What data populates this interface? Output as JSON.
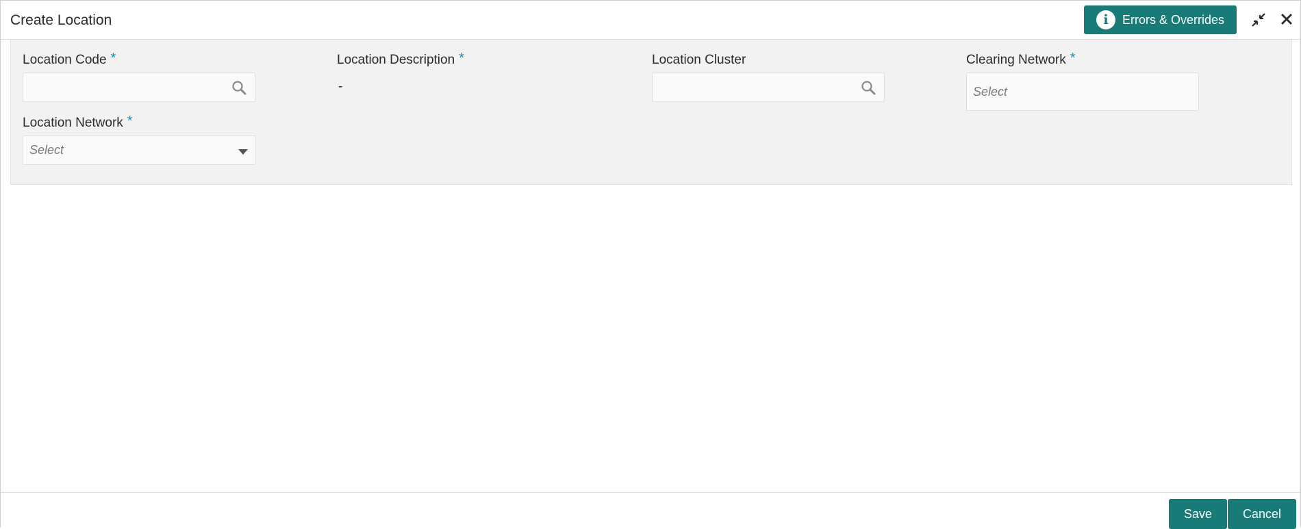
{
  "header": {
    "title": "Create Location",
    "errors_button_label": "Errors & Overrides",
    "info_icon": "info-icon",
    "minimize_icon": "minimize-icon",
    "close_icon": "close-icon"
  },
  "form": {
    "location_code": {
      "label": "Location Code",
      "required_mark": "*",
      "value": "",
      "icon": "search-icon"
    },
    "location_description": {
      "label": "Location Description",
      "required_mark": "*",
      "value": "-"
    },
    "location_cluster": {
      "label": "Location Cluster",
      "value": "",
      "icon": "search-icon"
    },
    "clearing_network": {
      "label": "Clearing Network",
      "required_mark": "*",
      "placeholder": "Select"
    },
    "location_network": {
      "label": "Location Network",
      "required_mark": "*",
      "placeholder": "Select",
      "icon": "chevron-down-icon"
    }
  },
  "footer": {
    "save_label": "Save",
    "cancel_label": "Cancel"
  },
  "colors": {
    "accent": "#187b78",
    "required": "#1a8fb0",
    "panel_bg": "#f2f2f2"
  }
}
